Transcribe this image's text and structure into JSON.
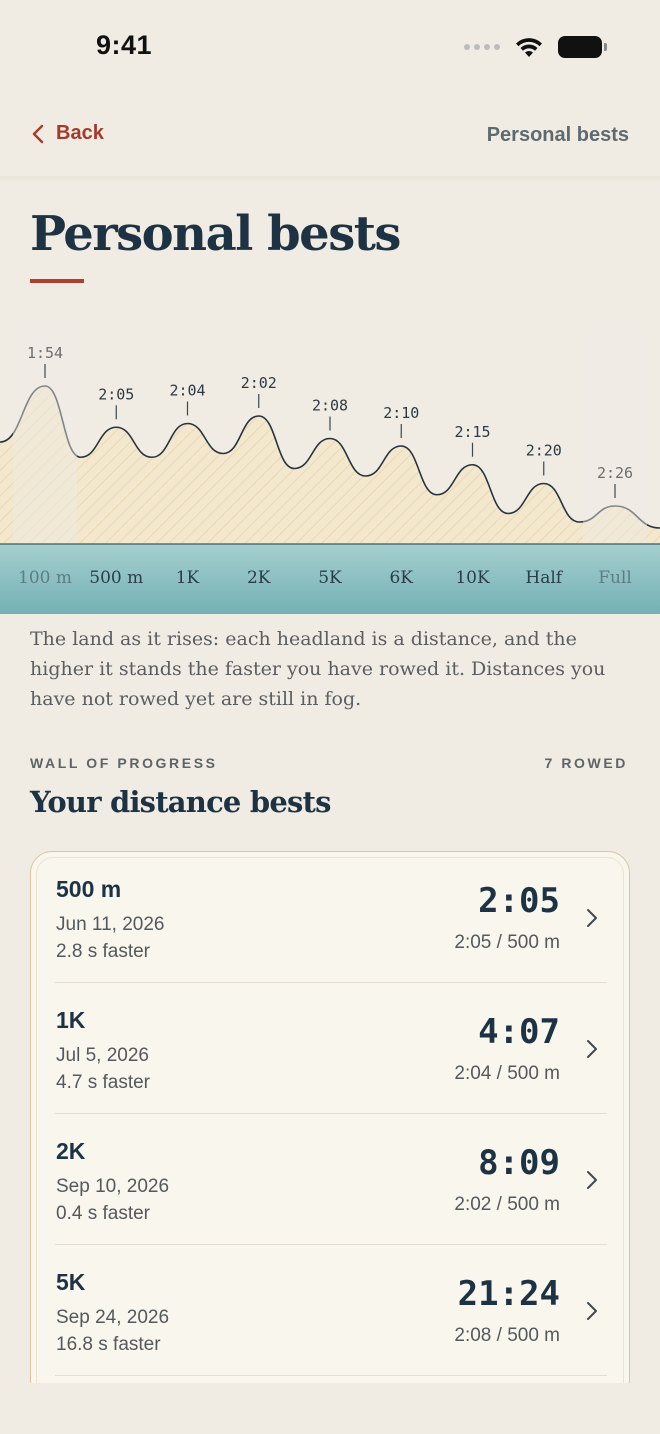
{
  "status": {
    "time": "9:41"
  },
  "nav": {
    "back_label": "Back",
    "title": "Personal bests"
  },
  "header": {
    "title": "Personal bests"
  },
  "chart_data": {
    "type": "area",
    "categories": [
      "100 m",
      "500 m",
      "1K",
      "2K",
      "5K",
      "6K",
      "10K",
      "Half",
      "Full"
    ],
    "pace_labels": [
      "1:54",
      "2:05",
      "2:04",
      "2:02",
      "2:08",
      "2:10",
      "2:15",
      "2:20",
      "2:26"
    ],
    "rowed": [
      false,
      true,
      true,
      true,
      true,
      true,
      true,
      true,
      false
    ],
    "ylabel": "",
    "xlabel": "",
    "title": ""
  },
  "description": "The land as it rises: each headland is a distance, and the higher it stands the faster you have rowed it. Distances you have not rowed yet are still in fog.",
  "section": {
    "kicker": "WALL OF PROGRESS",
    "count": "7 ROWED",
    "title": "Your distance bests"
  },
  "bests": [
    {
      "distance": "500 m",
      "date": "Jun 11, 2026",
      "delta": "2.8 s faster",
      "time": "2:05",
      "split": "2:05 / 500 m"
    },
    {
      "distance": "1K",
      "date": "Jul 5, 2026",
      "delta": "4.7 s faster",
      "time": "4:07",
      "split": "2:04 / 500 m"
    },
    {
      "distance": "2K",
      "date": "Sep 10, 2026",
      "delta": "0.4 s faster",
      "time": "8:09",
      "split": "2:02 / 500 m"
    },
    {
      "distance": "5K",
      "date": "Sep 24, 2026",
      "delta": "16.8 s faster",
      "time": "21:24",
      "split": "2:08 / 500 m"
    }
  ],
  "colors": {
    "accent": "#a63a2a",
    "ink": "#1d3344",
    "sand": "#f2e6cc",
    "sea": "#7fb8bc"
  }
}
